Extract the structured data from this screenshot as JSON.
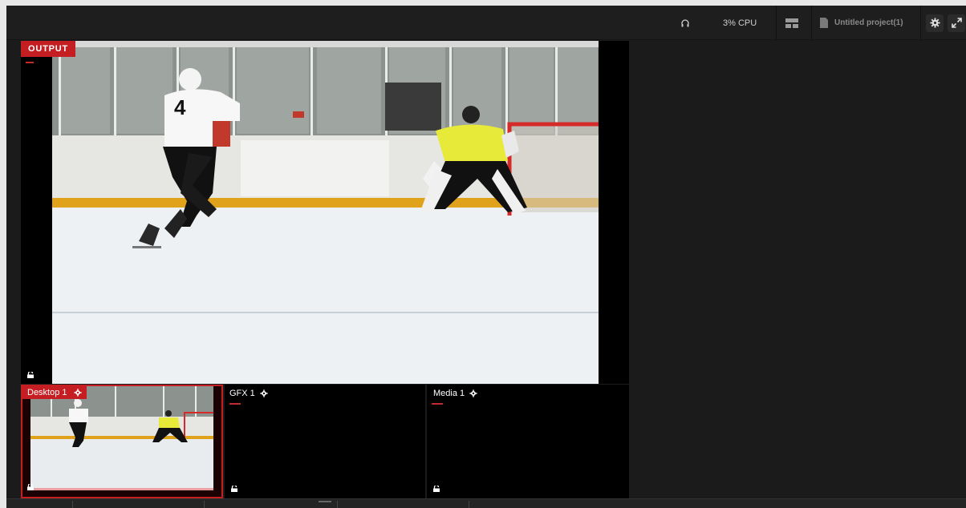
{
  "topbar": {
    "cpu_label": "3% CPU",
    "project_name": "Untitled project(1)"
  },
  "output": {
    "badge_label": "OUTPUT"
  },
  "sources": [
    {
      "label": "Desktop 1",
      "active": true
    },
    {
      "label": "GFX 1",
      "active": false
    },
    {
      "label": "Media 1",
      "active": false
    }
  ],
  "colors": {
    "accent": "#c41e22",
    "background": "#1b1b1b",
    "panel": "#000000"
  },
  "icons": [
    "headphones-icon",
    "layout-icon",
    "document-icon",
    "gear-icon",
    "expand-icon",
    "lock-icon"
  ]
}
